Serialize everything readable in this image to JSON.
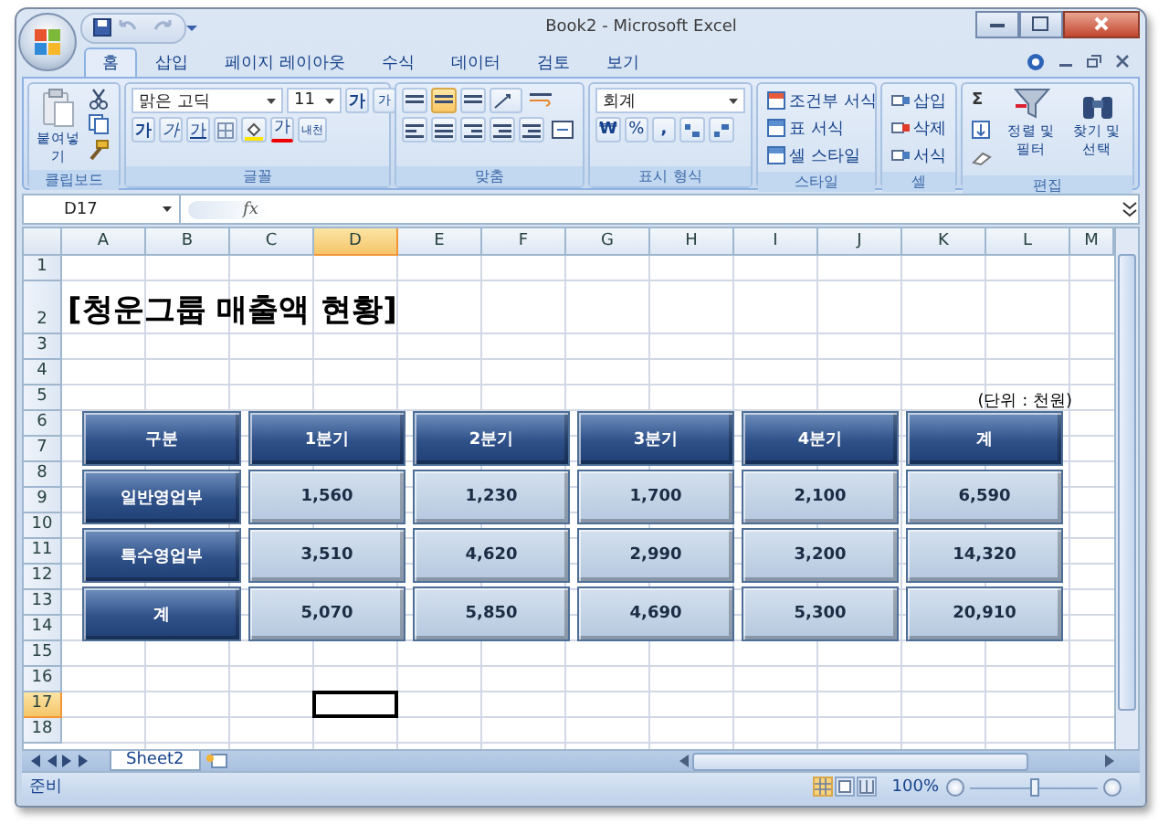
{
  "window": {
    "title": "Book2 - Microsoft Excel"
  },
  "tabs": [
    {
      "label": "홈",
      "selected": true
    },
    {
      "label": "삽입",
      "selected": false
    },
    {
      "label": "페이지 레이아웃",
      "selected": false
    },
    {
      "label": "수식",
      "selected": false
    },
    {
      "label": "데이터",
      "selected": false
    },
    {
      "label": "검토",
      "selected": false
    },
    {
      "label": "보기",
      "selected": false
    }
  ],
  "ribbon": {
    "clipboard": {
      "label": "클립보드",
      "paste": "붙여넣기"
    },
    "font": {
      "label": "글꼴",
      "family": "맑은 고딕",
      "size": "11",
      "grow": "가",
      "shrink": "가",
      "bold": "가",
      "italic": "가",
      "underline": "가",
      "font_color_button": "가",
      "phonetic": "내천"
    },
    "alignment": {
      "label": "맞춤"
    },
    "number": {
      "label": "표시 형식",
      "format": "회계",
      "currency": "₩",
      "percent": "%",
      "comma": ","
    },
    "styles": {
      "label": "스타일",
      "items": [
        "조건부 서식",
        "표 서식",
        "셀 스타일"
      ]
    },
    "cells": {
      "label": "셀",
      "items": [
        "삽입",
        "삭제",
        "서식"
      ]
    },
    "editing": {
      "label": "편집",
      "sum": "Σ",
      "sort": "정렬 및 필터",
      "find": "찾기 및 선택"
    }
  },
  "formula_bar": {
    "name_box": "D17",
    "function_button": "fx"
  },
  "sheet": {
    "columns": [
      {
        "label": "A",
        "selected": false
      },
      {
        "label": "B",
        "selected": false
      },
      {
        "label": "C",
        "selected": false
      },
      {
        "label": "D",
        "selected": true
      },
      {
        "label": "E",
        "selected": false
      },
      {
        "label": "F",
        "selected": false
      },
      {
        "label": "G",
        "selected": false
      },
      {
        "label": "H",
        "selected": false
      },
      {
        "label": "I",
        "selected": false
      },
      {
        "label": "J",
        "selected": false
      },
      {
        "label": "K",
        "selected": false
      },
      {
        "label": "L",
        "selected": false
      },
      {
        "label": "M",
        "selected": false
      }
    ],
    "rows": [
      {
        "label": "1",
        "selected": false
      },
      {
        "label": "2",
        "selected": false
      },
      {
        "label": "3",
        "selected": false
      },
      {
        "label": "4",
        "selected": false
      },
      {
        "label": "5",
        "selected": false
      },
      {
        "label": "6",
        "selected": false
      },
      {
        "label": "7",
        "selected": false
      },
      {
        "label": "8",
        "selected": false
      },
      {
        "label": "9",
        "selected": false
      },
      {
        "label": "10",
        "selected": false
      },
      {
        "label": "11",
        "selected": false
      },
      {
        "label": "12",
        "selected": false
      },
      {
        "label": "13",
        "selected": false
      },
      {
        "label": "14",
        "selected": false
      },
      {
        "label": "15",
        "selected": false
      },
      {
        "label": "16",
        "selected": false
      },
      {
        "label": "17",
        "selected": true
      },
      {
        "label": "18",
        "selected": false
      }
    ],
    "title": "[청운그룹 매출액 현황]",
    "unit": "(단위 : 천원)",
    "table": {
      "header": [
        "구분",
        "1분기",
        "2분기",
        "3분기",
        "4분기",
        "계"
      ],
      "rows": [
        [
          "일반영업부",
          "1,560",
          "1,230",
          "1,700",
          "2,100",
          "6,590"
        ],
        [
          "특수영업부",
          "3,510",
          "4,620",
          "2,990",
          "3,200",
          "14,320"
        ],
        [
          "계",
          "5,070",
          "5,850",
          "4,690",
          "5,300",
          "20,910"
        ]
      ]
    }
  },
  "sheet_tabs": [
    {
      "label": "Sheet2",
      "selected": true
    }
  ],
  "status_bar": {
    "status": "준비",
    "views": [
      {
        "kind": "normal",
        "selected": true
      },
      {
        "kind": "layout",
        "selected": false
      },
      {
        "kind": "pagebreak",
        "selected": false
      }
    ],
    "zoom": "100%",
    "zoom_slider": {
      "level": 0.5
    }
  }
}
